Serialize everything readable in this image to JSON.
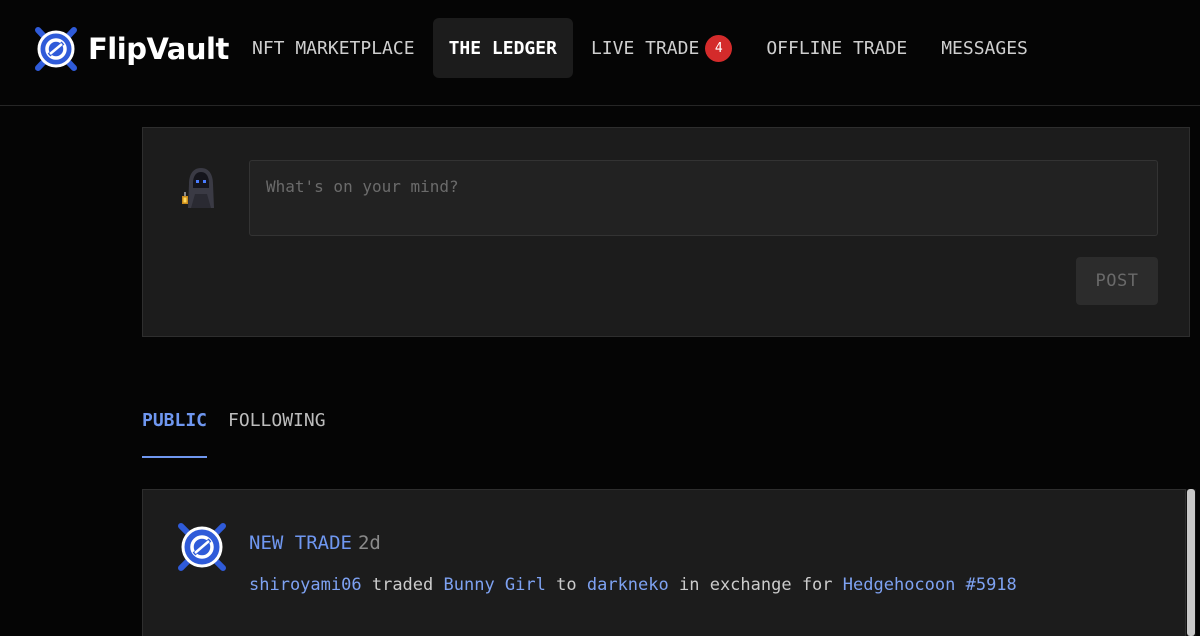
{
  "app": {
    "name": "FlipVault"
  },
  "colors": {
    "accent": "#6f97f0",
    "badge": "#d42b2b",
    "logo_blue": "#2f5bd9"
  },
  "nav": {
    "items": [
      {
        "label": "NFT MARKETPLACE"
      },
      {
        "label": "THE LEDGER",
        "active": true
      },
      {
        "label": "LIVE TRADE",
        "badge": "4"
      },
      {
        "label": "OFFLINE TRADE"
      },
      {
        "label": "MESSAGES"
      }
    ]
  },
  "composer": {
    "placeholder": "What's on your mind?",
    "post_label": "POST",
    "avatar_icon": "hooded-figure-lantern-icon"
  },
  "tabs": [
    {
      "label": "PUBLIC",
      "active": true
    },
    {
      "label": "FOLLOWING"
    }
  ],
  "feed": [
    {
      "type_label": "NEW TRADE",
      "time": "2d",
      "from_user": "shiroyami06",
      "verb": "traded",
      "item": "Bunny Girl",
      "to_word": "to",
      "to_user": "darkneko",
      "exchange_word": "in exchange for",
      "received_item": "Hedgehocoon #5918"
    }
  ]
}
